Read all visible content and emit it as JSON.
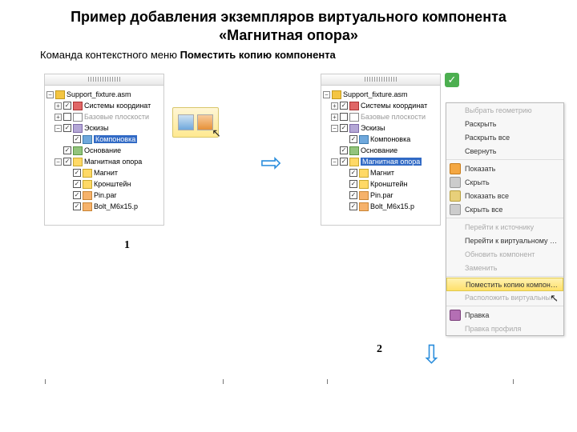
{
  "title_line1": "Пример добавления экземпляров виртуального компонента",
  "title_line2": "«Магнитная опора»",
  "subtitle_a": "Команда контекстного меню ",
  "subtitle_b": "Поместить копию компонента",
  "tree_left": {
    "root": "Support_fixture.asm",
    "coord": "Системы координат",
    "planes": "Базовые плоскости",
    "sketches": "Эскизы",
    "comp": "Компоновка",
    "base": "Основание",
    "virt": "Магнитная опора",
    "magnet": "Магнит",
    "bracket": "Кронштейн",
    "pin": "Pin.par",
    "bolt": "Bolt_M6x15.p"
  },
  "tree_right": {
    "root": "Support_fixture.asm",
    "coord": "Системы координат",
    "planes": "Базовые плоскости",
    "sketches": "Эскизы",
    "comp": "Компоновка",
    "base": "Основание",
    "virt": "Магнитная опора",
    "magnet": "Магнит",
    "bracket": "Кронштейн",
    "pin": "Pin.par",
    "bolt": "Bolt_M6x15.p"
  },
  "context_menu": {
    "items": [
      {
        "label": "Выбрать геометрию",
        "dim": true,
        "icon": "blank"
      },
      {
        "label": "Раскрыть",
        "dim": false,
        "icon": "blank"
      },
      {
        "label": "Раскрыть все",
        "dim": false,
        "icon": "blank"
      },
      {
        "label": "Свернуть",
        "dim": false,
        "icon": "blank"
      },
      {
        "sep": true
      },
      {
        "label": "Показать",
        "dim": false,
        "icon": "orange"
      },
      {
        "label": "Скрыть",
        "dim": false,
        "icon": "grey"
      },
      {
        "label": "Показать все",
        "dim": false,
        "icon": "box"
      },
      {
        "label": "Скрыть все",
        "dim": false,
        "icon": "grey"
      },
      {
        "sep": true
      },
      {
        "label": "Перейти к источнику",
        "dim": true,
        "icon": "blank"
      },
      {
        "label": "Перейти к виртуальному компоненту",
        "dim": false,
        "icon": "blank"
      },
      {
        "label": "Обновить компонент",
        "dim": true,
        "icon": "blank"
      },
      {
        "label": "Заменить",
        "dim": true,
        "icon": "blank"
      },
      {
        "sep": true
      },
      {
        "label": "Поместить копию компонента",
        "dim": false,
        "icon": "blank",
        "hl": true
      },
      {
        "label": "Расположить виртуальный компонент",
        "dim": true,
        "icon": "blank"
      },
      {
        "sep": true
      },
      {
        "label": "Правка",
        "dim": false,
        "icon": "purple"
      },
      {
        "label": "Правка профиля",
        "dim": true,
        "icon": "blank"
      }
    ]
  },
  "steps": {
    "s1": "1",
    "s2": "2"
  },
  "check": "✓"
}
